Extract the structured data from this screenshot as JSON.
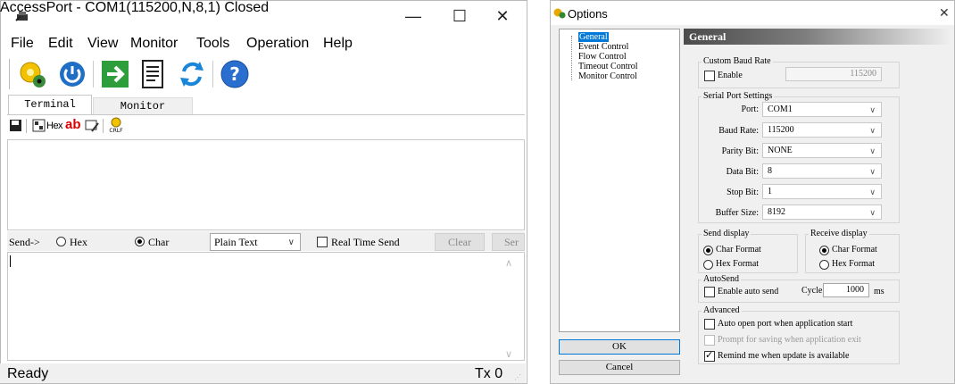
{
  "main_window": {
    "title": "AccessPort - COM1(115200,N,8,1) Closed",
    "menu": [
      "File",
      "Edit",
      "View",
      "Monitor",
      "Tools",
      "Operation",
      "Help"
    ],
    "tabs": [
      "Terminal",
      "Monitor"
    ],
    "subtoolbar_hex_label": "Hex",
    "subtoolbar_ab_label": "ab",
    "send_label": "Send->",
    "radio_hex": "Hex",
    "radio_char": "Char",
    "format_select": "Plain Text",
    "realtime_label": "Real Time Send",
    "clear_button": "Clear",
    "send_button": "Ser",
    "status": "Ready",
    "tx": "Tx 0"
  },
  "options_dialog": {
    "title": "Options",
    "tree": [
      "General",
      "Event Control",
      "Flow Control",
      "Timeout Control",
      "Monitor Control"
    ],
    "ok_button": "OK",
    "cancel_button": "Cancel",
    "section_header": "General",
    "custom_baud": {
      "group": "Custom Baud Rate",
      "enable_label": "Enable",
      "value": "115200"
    },
    "serial": {
      "group": "Serial Port Settings",
      "port_label": "Port:",
      "port": "COM1",
      "baud_label": "Baud Rate:",
      "baud": "115200",
      "parity_label": "Parity Bit:",
      "parity": "NONE",
      "data_label": "Data Bit:",
      "data": "8",
      "stop_label": "Stop Bit:",
      "stop": "1",
      "buffer_label": "Buffer Size:",
      "buffer": "8192"
    },
    "send_display": {
      "group": "Send display",
      "char": "Char Format",
      "hex": "Hex Format"
    },
    "receive_display": {
      "group": "Receive display",
      "char": "Char Format",
      "hex": "Hex Format"
    },
    "autosend": {
      "group": "AutoSend",
      "enable_label": "Enable auto send",
      "cycle_label": "Cycle",
      "cycle_value": "1000",
      "unit": "ms"
    },
    "advanced": {
      "group": "Advanced",
      "auto_open": "Auto open port when application start",
      "prompt_save": "Prompt for saving when application exit",
      "remind_update": "Remind me when update is available"
    }
  },
  "colors": {
    "accent_blue": "#0a64a4",
    "header_dark": "#4b4b4b",
    "selected_tree": "#0078d7"
  }
}
